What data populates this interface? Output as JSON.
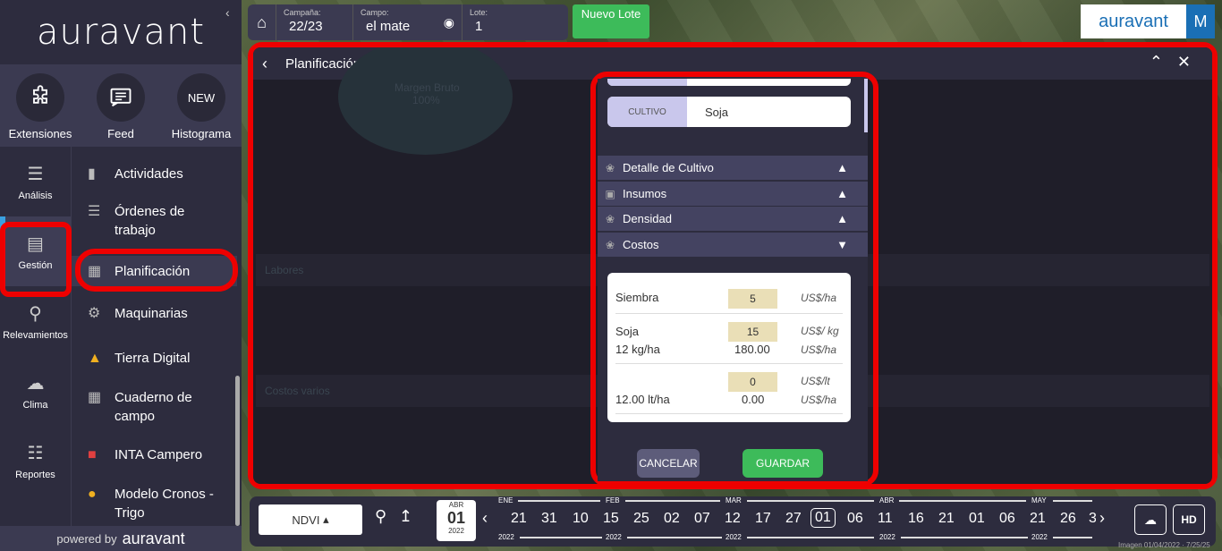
{
  "brand": {
    "name": "auravant",
    "user_initial": "M"
  },
  "sidebar": {
    "top": [
      {
        "label": "Extensiones",
        "icon": "puzzle-icon"
      },
      {
        "label": "Feed",
        "icon": "message-icon"
      },
      {
        "label": "Histograma",
        "badge": "NEW"
      }
    ],
    "rail": [
      "Análisis",
      "Gestión",
      "Relevamientos",
      "Clima",
      "Reportes"
    ],
    "submenu": [
      "Actividades",
      "Órdenes de trabajo",
      "Planificación",
      "Maquinarias",
      "Tierra Digital",
      "Cuaderno de campo",
      "INTA Campero",
      "Modelo Cronos - Trigo"
    ],
    "powered_by": "powered by",
    "powered_brand": "auravant"
  },
  "topbar": {
    "campaign_label": "Campaña:",
    "campaign_value": "22/23",
    "field_label": "Campo:",
    "field_value": "el mate",
    "lot_label": "Lote:",
    "lot_value": "1",
    "new_lot": "Nuevo Lote"
  },
  "panel": {
    "title": "Planificación",
    "bg_circle_label": "Margen Bruto",
    "bg_circle_value": "100%",
    "bg_labores": "Labores",
    "bg_costos": "Costos varios"
  },
  "modal": {
    "crop_label": "CULTIVO",
    "crop_value": "Soja",
    "sections": [
      "Detalle de Cultivo",
      "Insumos",
      "Densidad",
      "Costos"
    ],
    "costs": {
      "siembra_label": "Siembra",
      "siembra_value": "5",
      "siembra_unit": "US$/ha",
      "soja_label": "Soja",
      "soja_value": "15",
      "soja_unit": "US$/ kg",
      "soja_density": "12 kg/ha",
      "soja_total": "180.00",
      "soja_total_unit": "US$/ha",
      "other_value": "0",
      "other_unit": "US$/lt",
      "other_density": "12.00 lt/ha",
      "other_total": "0.00",
      "other_total_unit": "US$/ha"
    },
    "cancel": "CANCELAR",
    "save": "GUARDAR"
  },
  "timeline": {
    "layer": "NDVI",
    "selected_month": "ABR",
    "selected_day": "01",
    "selected_year": "2022",
    "months": [
      "ENE",
      "FEB",
      "MAR",
      "ABR",
      "MAY"
    ],
    "year": "2022",
    "days": [
      "21",
      "31",
      "10",
      "15",
      "25",
      "02",
      "07",
      "12",
      "17",
      "27",
      "01",
      "06",
      "11",
      "16",
      "21",
      "01",
      "06",
      "21",
      "26",
      "3"
    ],
    "hd": "HD",
    "image_date": "Imagen 01/04/2022 · 7/25/25"
  }
}
